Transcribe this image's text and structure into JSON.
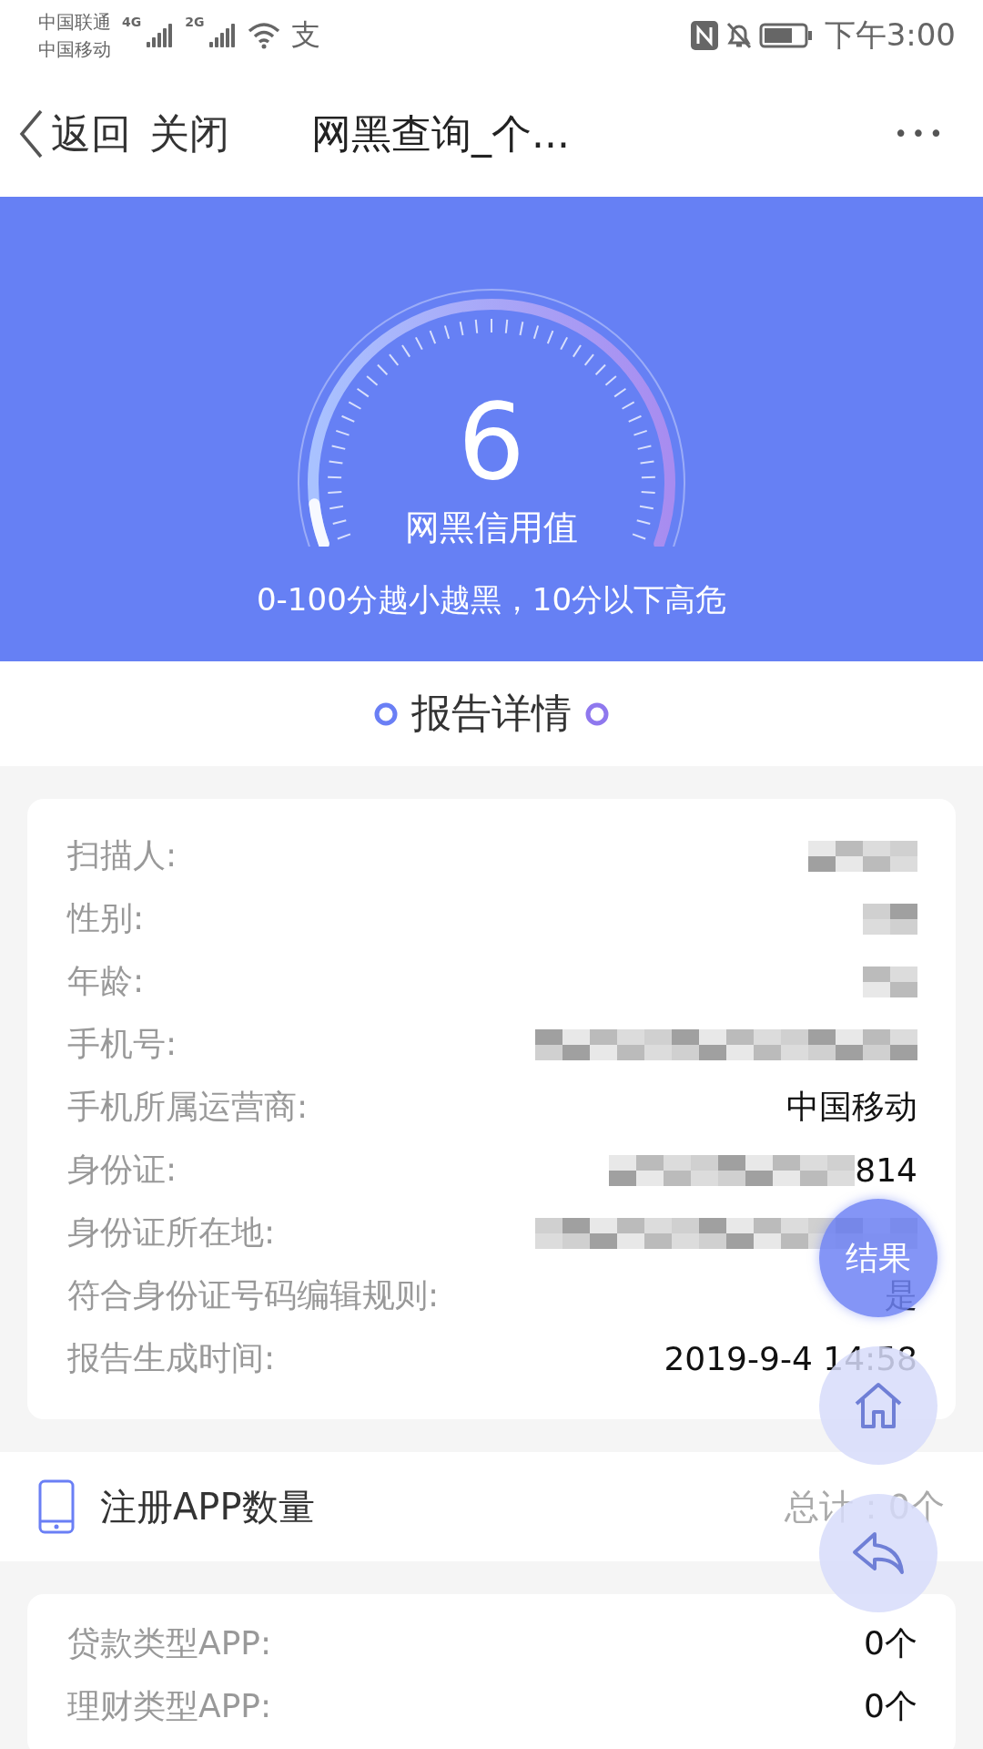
{
  "status_bar": {
    "carriers": [
      {
        "name": "中国联通",
        "network": "4G"
      },
      {
        "name": "中国移动",
        "network": "2G"
      }
    ],
    "notification_glyph": "支",
    "time": "下午3:00"
  },
  "nav_bar": {
    "back": "返回",
    "close": "关闭",
    "title": "网黑查询_个...",
    "more": "•••"
  },
  "score": {
    "value": "6",
    "label": "网黑信用值",
    "caption": "0-100分越小越黑，10分以下高危",
    "level": 0.06
  },
  "section_title": "报告详情",
  "details": [
    {
      "label": "扫描人:",
      "kind": "redacted"
    },
    {
      "label": "性别:",
      "kind": "redacted"
    },
    {
      "label": "年龄:",
      "kind": "redacted"
    },
    {
      "label": "手机号:",
      "kind": "redacted"
    },
    {
      "label": "手机所属运营商:",
      "kind": "text",
      "value": "中国移动"
    },
    {
      "label": "身份证:",
      "kind": "redacted",
      "value": "814"
    },
    {
      "label": "身份证所在地:",
      "kind": "redacted"
    },
    {
      "label": "符合身份证号码编辑规则:",
      "kind": "text",
      "value": "是"
    },
    {
      "label": "报告生成时间:",
      "kind": "text",
      "value": "2019-9-4 14:58"
    }
  ],
  "app_section": {
    "title": "注册APP数量",
    "total": "总计：0个"
  },
  "apps": [
    {
      "label": "贷款类型APP:",
      "value": "0个"
    },
    {
      "label": "理财类型APP:",
      "value": "0个"
    }
  ],
  "floating_buttons": [
    {
      "kind": "text",
      "label": "结果"
    },
    {
      "kind": "home"
    },
    {
      "kind": "reply"
    }
  ]
}
